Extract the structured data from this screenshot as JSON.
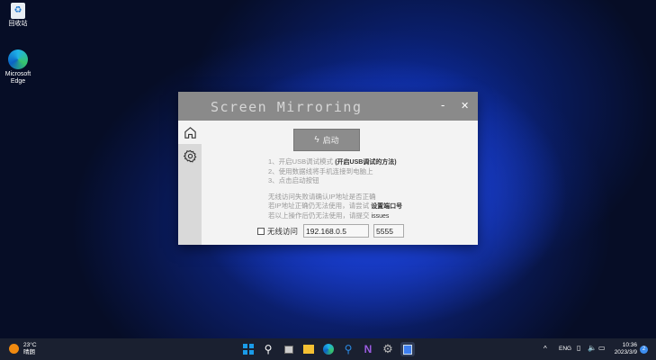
{
  "desktop": {
    "icons": [
      {
        "label": "回收站"
      },
      {
        "label": "Microsoft Edge"
      }
    ]
  },
  "window": {
    "title": "Screen Mirroring",
    "minimize": "-",
    "close": "✕",
    "start_button": "启动",
    "steps": [
      "1、开启USB调试模式",
      "2、使用数据线将手机连接到电脑上",
      "3、点击启动按钮"
    ],
    "usb_help_link": "(开启USB调试的方法)",
    "notes": [
      "无线访问失败请确认IP地址是否正确",
      "若IP地址正确仍无法使用，请尝试",
      "若以上操作后仍无法使用，请提交"
    ],
    "port_link": "设置端口号",
    "issues_link": "issues",
    "wireless_label": "无线访问",
    "ip_value": "192.168.0.5",
    "port_value": "5555"
  },
  "taskbar": {
    "weather_temp": "23°C",
    "weather_desc": "晴朗",
    "lang": "ENG",
    "time": "10:36",
    "date": "2023/3/9",
    "notif_count": "2"
  }
}
